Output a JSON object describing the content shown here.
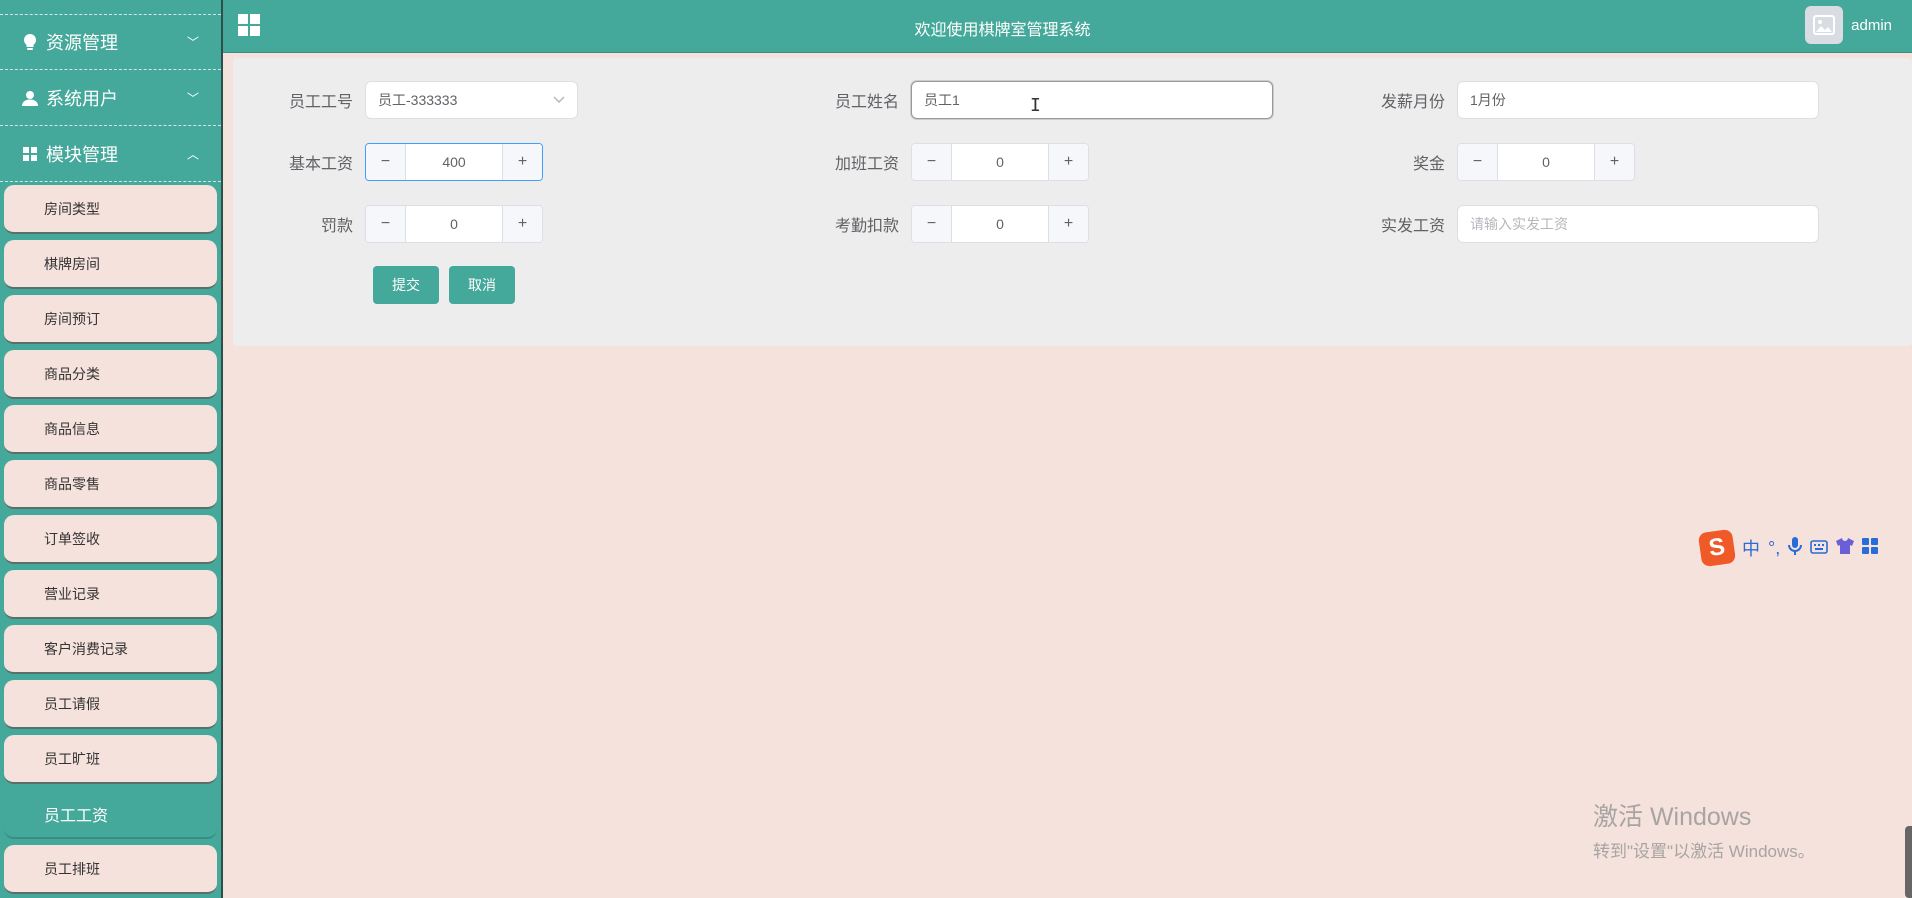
{
  "sidebar": {
    "groups": [
      {
        "label": "资源管理",
        "icon": "bulb-icon",
        "chevron": "﹀"
      },
      {
        "label": "系统用户",
        "icon": "user-icon",
        "chevron": "﹀"
      },
      {
        "label": "模块管理",
        "icon": "grid-icon",
        "chevron": "︿"
      }
    ],
    "items": [
      {
        "label": "房间类型"
      },
      {
        "label": "棋牌房间"
      },
      {
        "label": "房间预订"
      },
      {
        "label": "商品分类"
      },
      {
        "label": "商品信息"
      },
      {
        "label": "商品零售"
      },
      {
        "label": "订单签收"
      },
      {
        "label": "营业记录"
      },
      {
        "label": "客户消费记录"
      },
      {
        "label": "员工请假"
      },
      {
        "label": "员工旷班"
      },
      {
        "label": "员工工资"
      },
      {
        "label": "员工排班"
      }
    ],
    "active_item": "员工工资"
  },
  "header": {
    "title": "欢迎使用棋牌室管理系统",
    "username": "admin"
  },
  "form": {
    "employee_no": {
      "label": "员工工号",
      "value": "员工-333333"
    },
    "employee_name": {
      "label": "员工姓名",
      "value": "员工1"
    },
    "pay_month": {
      "label": "发薪月份",
      "value": "1月份"
    },
    "base_salary": {
      "label": "基本工资",
      "value": "400"
    },
    "overtime_pay": {
      "label": "加班工资",
      "value": "0"
    },
    "bonus": {
      "label": "奖金",
      "value": "0"
    },
    "fine": {
      "label": "罚款",
      "value": "0"
    },
    "attendance_deduction": {
      "label": "考勤扣款",
      "value": "0"
    },
    "actual_salary": {
      "label": "实发工资",
      "placeholder": "请输入实发工资"
    },
    "stepper": {
      "minus": "−",
      "plus": "+"
    },
    "submit_label": "提交",
    "cancel_label": "取消"
  },
  "ime": {
    "logo": "S",
    "mode": "中",
    "punct": "°,"
  },
  "watermark": {
    "line1": "激活 Windows",
    "line2": "转到\"设置\"以激活 Windows。"
  },
  "colors": {
    "accent": "#44a99a",
    "background": "#f5e2dc",
    "card": "#ededed"
  }
}
